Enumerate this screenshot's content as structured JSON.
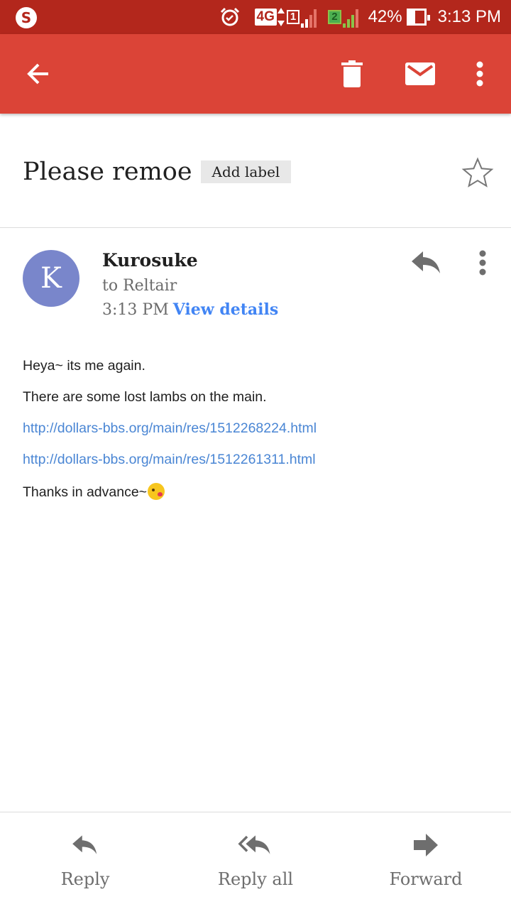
{
  "status_bar": {
    "app_icon": "S",
    "network_type": "4G",
    "sim1": "1",
    "sim2": "2",
    "battery_percent_text": "42%",
    "battery_level": 0.42,
    "time": "3:13 PM",
    "icons": [
      "alarm-icon",
      "signal-icon",
      "battery-icon"
    ]
  },
  "app_bar": {
    "icons": [
      "back-arrow-icon",
      "trash-icon",
      "mail-icon",
      "more-vert-icon"
    ],
    "color": "#db4437"
  },
  "email": {
    "subject": "Please remoe",
    "add_label": "Add label",
    "avatar_letter": "K",
    "avatar_color": "#7986cb",
    "sender": "Kurosuke",
    "recipient": "to Reltair",
    "time": "3:13 PM",
    "view_details": "View details",
    "body": {
      "line1": "Heya~ its me again.",
      "line2": "There are some lost lambs on the main.",
      "link1": "http://dollars-bbs.org/main/res/1512268224.html",
      "link2": "http://dollars-bbs.org/main/res/1512261311.html",
      "line3": "Thanks in advance~"
    }
  },
  "bottom_actions": {
    "reply": "Reply",
    "reply_all": "Reply all",
    "forward": "Forward"
  }
}
